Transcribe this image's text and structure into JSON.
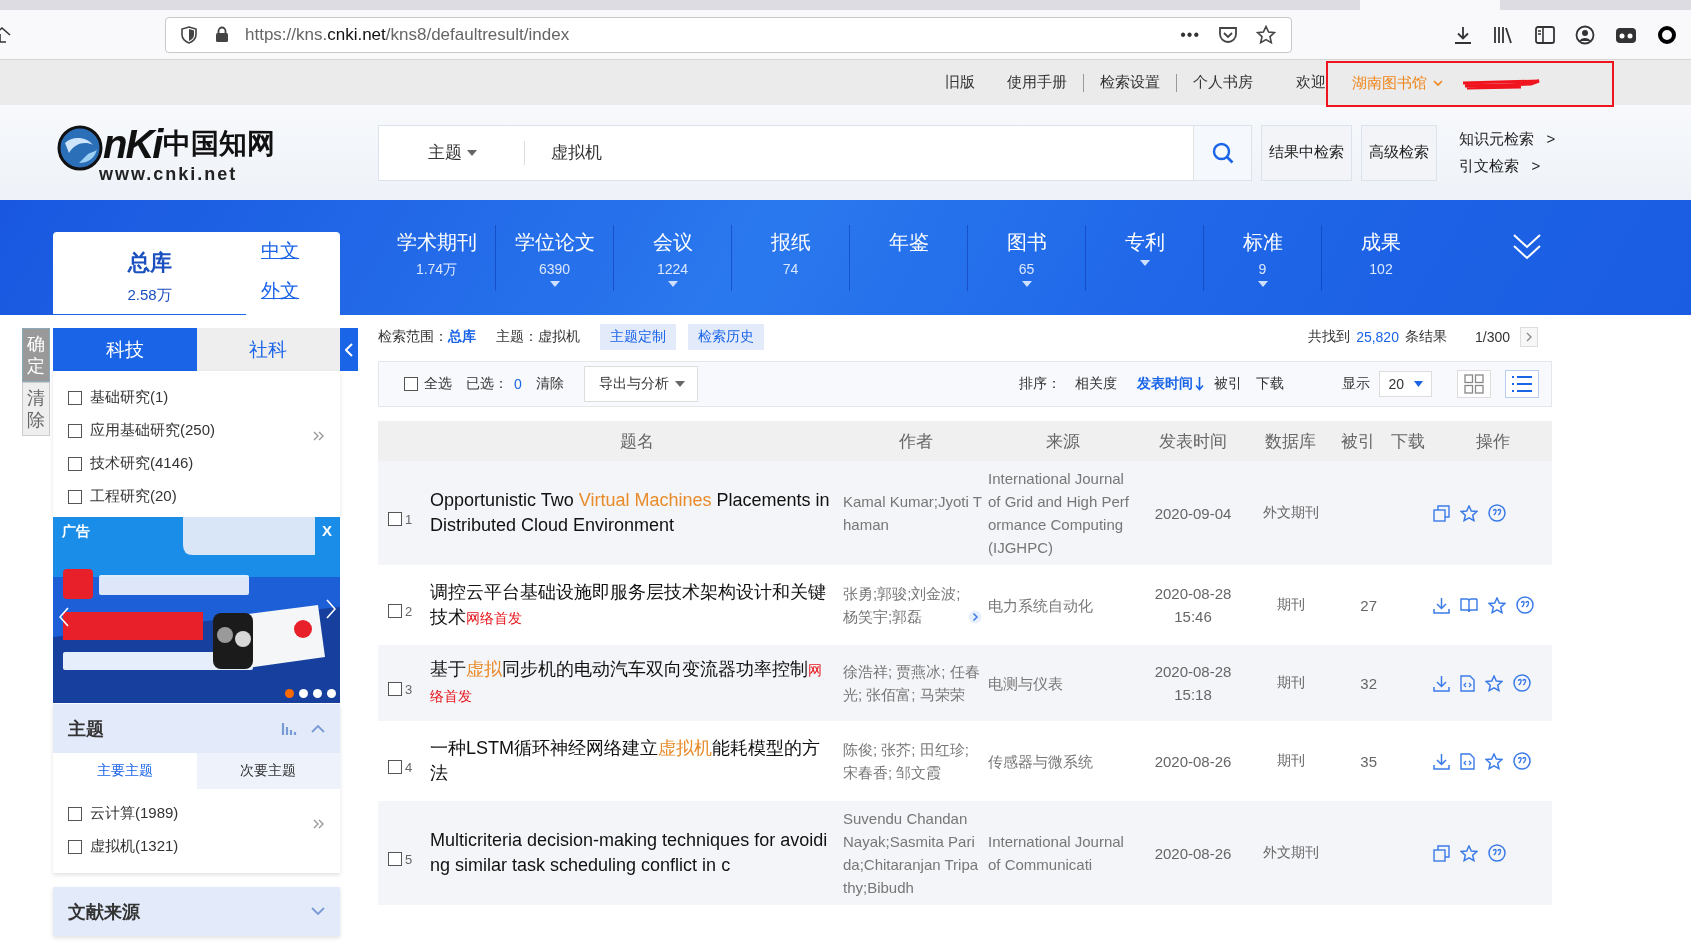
{
  "browser": {
    "url": {
      "prefix": "https://kns.",
      "domain": "cnki.net",
      "path": "/kns8/defaultresult/index"
    },
    "more": "•••"
  },
  "top_links": [
    "旧版",
    "使用手册",
    "检索设置",
    "个人书房"
  ],
  "welcome": "欢迎",
  "library": "湖南图书馆",
  "highlight_box": true,
  "name_redacted": true,
  "logo": {
    "mark": "nKi",
    "name": "中国知网",
    "site": "www.cnki.net"
  },
  "search": {
    "field": "主题",
    "value": "虚拟机",
    "buttons": [
      "结果中检索",
      "高级检索"
    ],
    "links": [
      {
        "label": "知识元检索",
        "arrow": ">"
      },
      {
        "label": "引文检索",
        "arrow": ">"
      }
    ]
  },
  "nav": {
    "all": {
      "label": "总库",
      "count": "2.58万"
    },
    "languages": [
      "中文",
      "外文"
    ],
    "categories": [
      {
        "label": "学术期刊",
        "count": "1.74万",
        "dropdown": false
      },
      {
        "label": "学位论文",
        "count": "6390",
        "dropdown": true
      },
      {
        "label": "会议",
        "count": "1224",
        "dropdown": true
      },
      {
        "label": "报纸",
        "count": "74",
        "dropdown": false
      },
      {
        "label": "年鉴",
        "dropdown": false
      },
      {
        "label": "图书",
        "count": "65",
        "dropdown": true
      },
      {
        "label": "专利",
        "dropdown": true
      },
      {
        "label": "标准",
        "count": "9",
        "dropdown": true
      },
      {
        "label": "成果",
        "count": "102",
        "dropdown": false
      }
    ]
  },
  "sidebar": {
    "actions": [
      "确定",
      "清除"
    ],
    "tabs": [
      {
        "label": "科技",
        "selected": true
      },
      {
        "label": "社科",
        "selected": false
      }
    ],
    "filters": [
      {
        "label": "基础研究(1)",
        "checked": false
      },
      {
        "label": "应用基础研究(250)",
        "checked": false
      },
      {
        "label": "技术研究(4146)",
        "checked": false
      },
      {
        "label": "工程研究(20)",
        "checked": false
      }
    ],
    "ad": {
      "label": "广告",
      "close": "X",
      "slides": [
        {
          "selected": true
        },
        {
          "selected": false
        },
        {
          "selected": false
        },
        {
          "selected": false
        }
      ]
    },
    "topic": {
      "title": "主题",
      "expanded": true,
      "tabs": [
        {
          "label": "主要主题",
          "selected": true
        },
        {
          "label": "次要主题",
          "selected": false
        }
      ],
      "filters": [
        {
          "label": "云计算(1989)",
          "checked": false
        },
        {
          "label": "虚拟机(1321)",
          "checked": false
        }
      ]
    },
    "source": {
      "title": "文献来源",
      "expanded": false
    }
  },
  "results": {
    "scope_label": "检索范围：",
    "scope": "总库",
    "query": "主题：虚拟机",
    "scope_buttons": [
      "主题定制",
      "检索历史"
    ],
    "found_prefix": "共找到",
    "total": "25,820",
    "found_suffix": "条结果",
    "page": "1/300",
    "toolbar": {
      "select_all": {
        "label": "全选",
        "checked": false
      },
      "selected_label": "已选：",
      "selected_count": "0",
      "clear": "清除",
      "export": "导出与分析",
      "sort_label": "排序：",
      "sorts": [
        {
          "label": "相关度",
          "selected": false
        },
        {
          "label": "发表时间",
          "selected": true
        },
        {
          "label": "被引",
          "selected": false
        },
        {
          "label": "下载",
          "selected": false
        }
      ],
      "show_label": "显示",
      "page_size": "20",
      "views": [
        {
          "kind": "grid",
          "selected": false
        },
        {
          "kind": "list",
          "selected": true
        }
      ]
    },
    "columns": [
      "题名",
      "作者",
      "来源",
      "发表时间",
      "数据库",
      "被引",
      "下载",
      "操作"
    ],
    "rows": [
      {
        "index": "1",
        "checked": false,
        "title": [
          {
            "text": "Opportunistic Two ",
            "highlight": false
          },
          {
            "text": "Virtual Machines",
            "highlight": true
          },
          {
            "text": " Placements in Distributed Cloud Environment",
            "highlight": false
          }
        ],
        "authors": "Kamal Kumar;Jyoti Thaman",
        "authors_more": false,
        "source": "International Journal of Grid and High Performance Computing (IJGHPC)",
        "date": "2020-09-04",
        "database": "外文期刊",
        "actions": [
          {
            "kind": "copy"
          },
          {
            "kind": "star"
          },
          {
            "kind": "quote"
          }
        ]
      },
      {
        "index": "2",
        "checked": false,
        "title": [
          {
            "text": "调控云平台基础设施即服务层技术架构设计和关键技术",
            "highlight": false
          }
        ],
        "badge": "网络首发",
        "authors": "张勇;郭骏;刘金波;杨笑宇;郭磊",
        "authors_more": true,
        "source": "电力系统自动化",
        "date": "2020-08-28 15:46",
        "database": "期刊",
        "cited": "27",
        "actions": [
          {
            "kind": "download"
          },
          {
            "kind": "read"
          },
          {
            "kind": "star"
          },
          {
            "kind": "quote"
          }
        ]
      },
      {
        "index": "3",
        "checked": false,
        "title": [
          {
            "text": "基于",
            "highlight": false
          },
          {
            "text": "虚拟",
            "highlight": true
          },
          {
            "text": "同步机的电动汽车双向变流器功率控制",
            "highlight": false
          }
        ],
        "badge": "网络首发",
        "authors": "徐浩祥; 贾燕冰; 任春光; 张佰富; 马荣荣",
        "authors_more": false,
        "source": "电测与仪表",
        "date": "2020-08-28 15:18",
        "database": "期刊",
        "cited": "32",
        "actions": [
          {
            "kind": "download"
          },
          {
            "kind": "html"
          },
          {
            "kind": "star"
          },
          {
            "kind": "quote"
          }
        ]
      },
      {
        "index": "4",
        "checked": false,
        "title": [
          {
            "text": "一种LSTM循环神经网络建立",
            "highlight": false
          },
          {
            "text": "虚拟机",
            "highlight": true
          },
          {
            "text": "能耗模型的方法",
            "highlight": false
          }
        ],
        "authors": "陈俊; 张芥; 田红珍; 宋春香; 邹文霞",
        "authors_more": false,
        "source": "传感器与微系统",
        "date": "2020-08-26",
        "database": "期刊",
        "cited": "35",
        "actions": [
          {
            "kind": "download"
          },
          {
            "kind": "html"
          },
          {
            "kind": "star"
          },
          {
            "kind": "quote"
          }
        ]
      },
      {
        "index": "5",
        "checked": false,
        "title": [
          {
            "text": "Multicriteria decision-making techniques for avoiding similar task scheduling conflict in c",
            "highlight": false
          }
        ],
        "authors": "Suvendu Chandan Nayak;Sasmita Parida;Chitaranjan Tripathy;Bibudh",
        "authors_more": false,
        "source": "International Journal of Communicati",
        "date": "2020-08-26",
        "database": "外文期刊",
        "actions": [
          {
            "kind": "copy"
          },
          {
            "kind": "star"
          },
          {
            "kind": "quote"
          }
        ]
      }
    ]
  }
}
